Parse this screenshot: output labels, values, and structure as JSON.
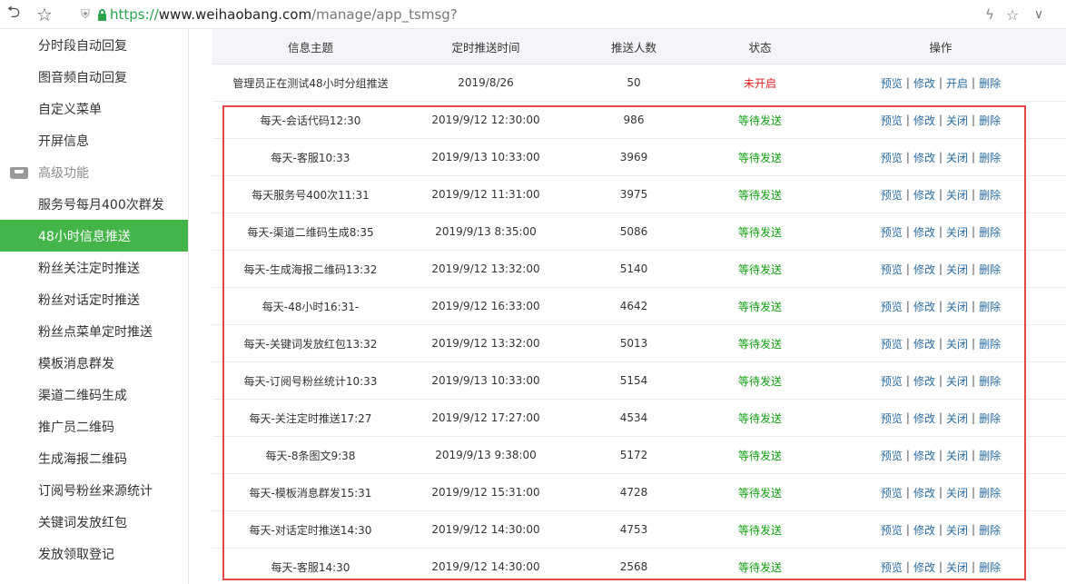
{
  "browser": {
    "url_scheme": "https://",
    "url_host": "www.weihaobang.com",
    "url_path": "/manage/app_tsmsg?",
    "icons": [
      "back-icon",
      "star-icon",
      "shield-icon",
      "lock-icon",
      "bolt-icon",
      "star-icon",
      "chevron-down-icon"
    ]
  },
  "sidebar": {
    "items_top": [
      {
        "label": "分时段自动回复"
      },
      {
        "label": "图音频自动回复"
      },
      {
        "label": "自定义菜单"
      },
      {
        "label": "开屏信息"
      }
    ],
    "section_label": "高级功能",
    "section_icon": "tray-icon",
    "items": [
      {
        "label": "服务号每月400次群发"
      },
      {
        "label": "48小时信息推送",
        "active": true
      },
      {
        "label": "粉丝关注定时推送"
      },
      {
        "label": "粉丝对话定时推送"
      },
      {
        "label": "粉丝点菜单定时推送"
      },
      {
        "label": "模板消息群发"
      },
      {
        "label": "渠道二维码生成"
      },
      {
        "label": "推广员二维码"
      },
      {
        "label": "生成海报二维码"
      },
      {
        "label": "订阅号粉丝来源统计"
      },
      {
        "label": "关键词发放红包"
      },
      {
        "label": "发放领取登记"
      }
    ],
    "active_color": "#44b549"
  },
  "table": {
    "headers": [
      "信息主题",
      "定时推送时间",
      "推送人数",
      "状态",
      "操作"
    ],
    "ops_separator": "|",
    "rows": [
      {
        "title": "管理员正在测试48小时分组推送",
        "time": "2019/8/26",
        "count": "50",
        "status": "未开启",
        "ops": [
          "预览",
          "修改",
          "开启",
          "删除"
        ]
      },
      {
        "title": "每天-会话代码12:30",
        "time": "2019/9/12 12:30:00",
        "count": "986",
        "status": "等待发送",
        "ops": [
          "预览",
          "修改",
          "关闭",
          "删除"
        ]
      },
      {
        "title": "每天-客服10:33",
        "time": "2019/9/13 10:33:00",
        "count": "3969",
        "status": "等待发送",
        "ops": [
          "预览",
          "修改",
          "关闭",
          "删除"
        ]
      },
      {
        "title": "每天服务号400次11:31",
        "time": "2019/9/12 11:31:00",
        "count": "3975",
        "status": "等待发送",
        "ops": [
          "预览",
          "修改",
          "关闭",
          "删除"
        ]
      },
      {
        "title": "每天-渠道二维码生成8:35",
        "time": "2019/9/13 8:35:00",
        "count": "5086",
        "status": "等待发送",
        "ops": [
          "预览",
          "修改",
          "关闭",
          "删除"
        ]
      },
      {
        "title": "每天-生成海报二维码13:32",
        "time": "2019/9/12 13:32:00",
        "count": "5140",
        "status": "等待发送",
        "ops": [
          "预览",
          "修改",
          "关闭",
          "删除"
        ]
      },
      {
        "title": "每天-48小时16:31-",
        "time": "2019/9/12 16:33:00",
        "count": "4642",
        "status": "等待发送",
        "ops": [
          "预览",
          "修改",
          "关闭",
          "删除"
        ]
      },
      {
        "title": "每天-关键词发放红包13:32",
        "time": "2019/9/12 13:32:00",
        "count": "5013",
        "status": "等待发送",
        "ops": [
          "预览",
          "修改",
          "关闭",
          "删除"
        ]
      },
      {
        "title": "每天-订阅号粉丝统计10:33",
        "time": "2019/9/13 10:33:00",
        "count": "5154",
        "status": "等待发送",
        "ops": [
          "预览",
          "修改",
          "关闭",
          "删除"
        ]
      },
      {
        "title": "每天-关注定时推送17:27",
        "time": "2019/9/12 17:27:00",
        "count": "4534",
        "status": "等待发送",
        "ops": [
          "预览",
          "修改",
          "关闭",
          "删除"
        ]
      },
      {
        "title": "每天-8条图文9:38",
        "time": "2019/9/13 9:38:00",
        "count": "5172",
        "status": "等待发送",
        "ops": [
          "预览",
          "修改",
          "关闭",
          "删除"
        ]
      },
      {
        "title": "每天-模板消息群发15:31",
        "time": "2019/9/12 15:31:00",
        "count": "4728",
        "status": "等待发送",
        "ops": [
          "预览",
          "修改",
          "关闭",
          "删除"
        ]
      },
      {
        "title": "每天-对话定时推送14:30",
        "time": "2019/9/12 14:30:00",
        "count": "4753",
        "status": "等待发送",
        "ops": [
          "预览",
          "修改",
          "关闭",
          "删除"
        ]
      },
      {
        "title": "每天-客服14:30",
        "time": "2019/9/12 14:30:00",
        "count": "2568",
        "status": "等待发送",
        "ops": [
          "预览",
          "修改",
          "关闭",
          "删除"
        ]
      }
    ]
  },
  "colors": {
    "status_off": "#e02020",
    "status_wait": "#12a012",
    "link": "#2b6ca3",
    "highlight_border": "#e04747"
  }
}
